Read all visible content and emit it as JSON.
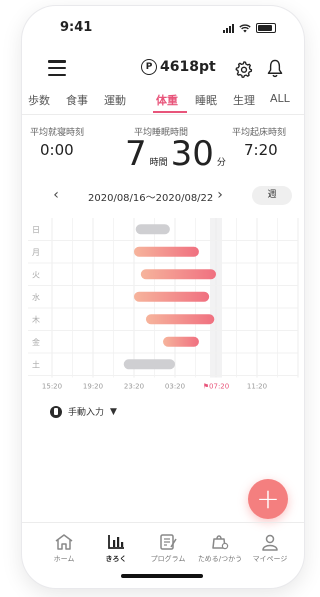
{
  "status_bar": {
    "time": "9:41"
  },
  "header": {
    "points": "4618pt",
    "points_mark": "P"
  },
  "tabs": [
    {
      "label": "歩数"
    },
    {
      "label": "食事"
    },
    {
      "label": "運動"
    },
    {
      "label": "体重"
    },
    {
      "label": "睡眠"
    },
    {
      "label": "生理"
    },
    {
      "label": "ALL"
    }
  ],
  "summary": {
    "avg_bedtime_label": "平均就寝時刻",
    "avg_bedtime": "0:00",
    "avg_sleep_label": "平均睡眠時間",
    "avg_sleep_hours": "7",
    "hours_unit": "時間",
    "avg_sleep_minutes": "30",
    "minutes_unit": "分",
    "avg_wake_label": "平均起床時刻",
    "avg_wake": "7:20"
  },
  "week_nav": {
    "prev": "‹",
    "next": "›",
    "date_range": "2020/08/16〜2020/08/22",
    "period_button": "週"
  },
  "chart_data": {
    "type": "bar",
    "subtype": "horizontal-range",
    "days": [
      "日",
      "月",
      "火",
      "水",
      "木",
      "金",
      "土"
    ],
    "x_ticks": [
      "15:20",
      "19:20",
      "23:20",
      "03:20",
      "07:20",
      "11:20"
    ],
    "highlighted_tick": "07:20",
    "highlighted_tick_mark": "⚑",
    "highlight_color": "#e8547a",
    "bar_color_start": "#f6b49c",
    "bar_color_end": "#f07080",
    "past_bar_color": "#cfcfd2",
    "bars": [
      {
        "day": "日",
        "start": "23:30",
        "end": "02:50",
        "style": "grey"
      },
      {
        "day": "月",
        "start": "23:20",
        "end": "05:40",
        "style": "gradient"
      },
      {
        "day": "火",
        "start": "00:00",
        "end": "07:20",
        "style": "gradient"
      },
      {
        "day": "水",
        "start": "23:20",
        "end": "06:40",
        "style": "gradient"
      },
      {
        "day": "木",
        "start": "00:30",
        "end": "07:10",
        "style": "gradient"
      },
      {
        "day": "金",
        "start": "02:10",
        "end": "05:40",
        "style": "gradient"
      },
      {
        "day": "土",
        "start": "22:20",
        "end": "03:20",
        "style": "grey"
      }
    ]
  },
  "manual_input": {
    "label": "手動入力",
    "caret": "▼"
  },
  "fab": {
    "label": "+"
  },
  "bottom_nav": [
    {
      "label": "ホーム",
      "icon": "home-icon"
    },
    {
      "label": "きろく",
      "icon": "bar-chart-icon"
    },
    {
      "label": "プログラム",
      "icon": "program-icon"
    },
    {
      "label": "ためる/つかう",
      "icon": "wallet-icon"
    },
    {
      "label": "マイページ",
      "icon": "person-icon"
    }
  ]
}
